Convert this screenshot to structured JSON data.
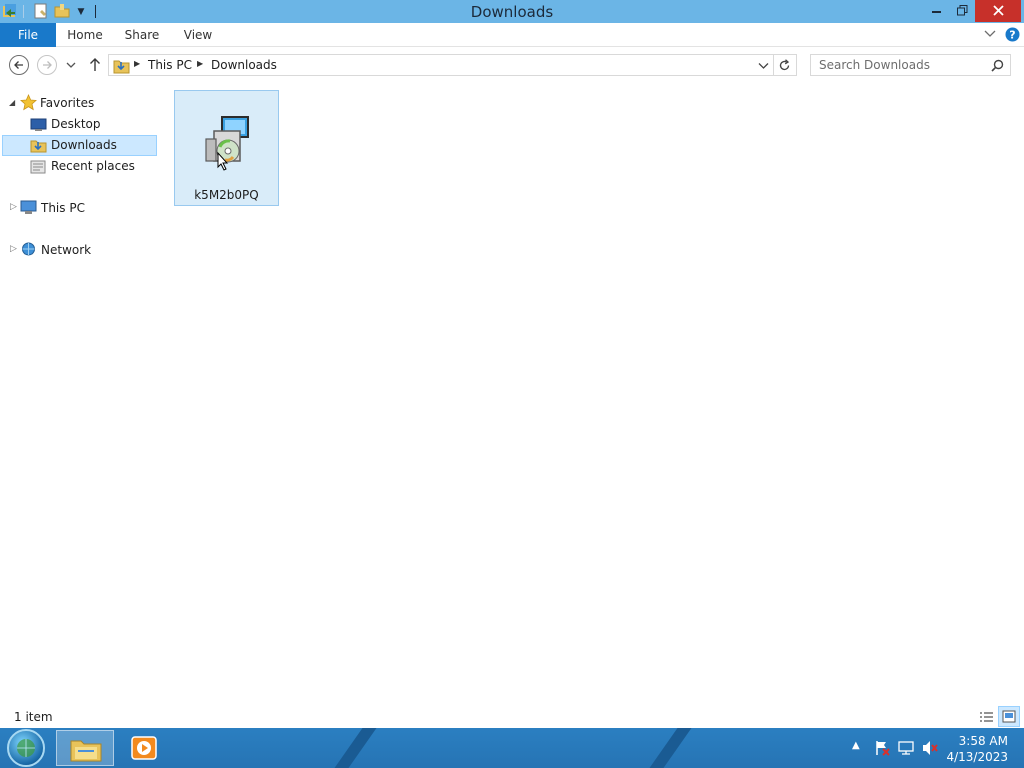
{
  "window": {
    "title": "Downloads"
  },
  "ribbon": {
    "tabs": [
      "File",
      "Home",
      "Share",
      "View"
    ]
  },
  "address": {
    "crumbs": [
      "This PC",
      "Downloads"
    ]
  },
  "search": {
    "placeholder": "Search Downloads"
  },
  "nav": {
    "favorites": "Favorites",
    "items": [
      "Desktop",
      "Downloads",
      "Recent places"
    ],
    "this_pc": "This PC",
    "network": "Network"
  },
  "files": [
    {
      "name": "k5M2b0PQ",
      "icon": "installer-icon"
    }
  ],
  "status": {
    "count": "1 item"
  },
  "taskbar": {
    "time": "3:58 AM",
    "date": "4/13/2023"
  },
  "colors": {
    "titlebar": "#6bb5e6",
    "file_tab": "#1979ca",
    "selection": "#cce8ff",
    "taskbar": "#2674b4"
  }
}
